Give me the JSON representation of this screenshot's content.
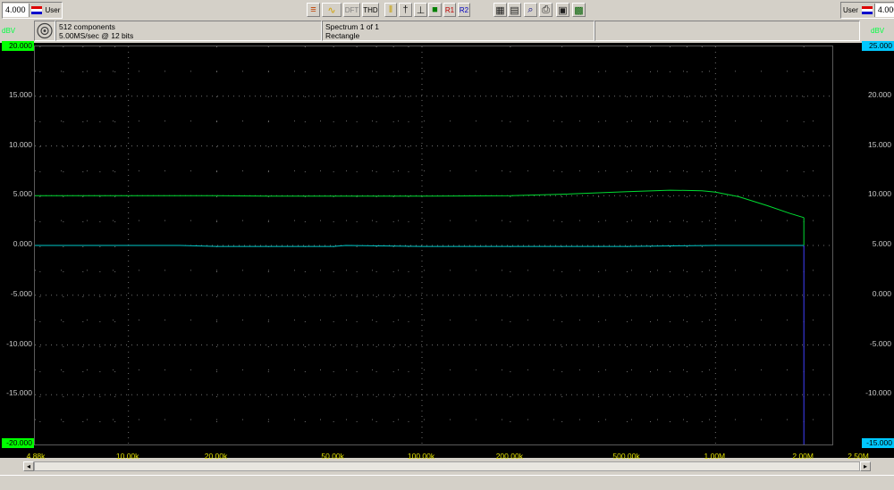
{
  "toolbar": {
    "left_scale": "4.000",
    "right_scale": "4.000",
    "user_label": "User",
    "buttons": [
      {
        "label": "",
        "icon": "filter-icon"
      },
      {
        "label": "",
        "icon": "waveform-icon"
      },
      {
        "label": "DFT",
        "icon": ""
      },
      {
        "label": "THD",
        "icon": ""
      },
      {
        "label": "",
        "icon": "pause-bars-icon"
      },
      {
        "label": "",
        "icon": "marker-icon"
      },
      {
        "label": "",
        "icon": "measure-icon"
      },
      {
        "label": "",
        "icon": "reference-plot-icon"
      },
      {
        "label": "R1",
        "icon": ""
      },
      {
        "label": "R2",
        "icon": ""
      },
      {
        "label": "",
        "icon": "settings-grid-icon"
      },
      {
        "label": "",
        "icon": "sheets-icon"
      },
      {
        "label": "",
        "icon": "zoom-icon"
      },
      {
        "label": "",
        "icon": "print-icon"
      },
      {
        "label": "",
        "icon": "save-icon"
      },
      {
        "label": "",
        "icon": "display-icon"
      }
    ]
  },
  "info": {
    "components": "512 components",
    "rate": "5.00MS/sec @ 12 bits",
    "spectrum": "Spectrum 1 of 1",
    "window": "Rectangle"
  },
  "colors": {
    "trace_a": "#00dc32",
    "trace_b": "#00c8c8",
    "grid_dot": "#707070",
    "left_box": "#00ff00",
    "right_box": "#00c8ff",
    "x_label": "#e0e000"
  },
  "chart_data": {
    "type": "line",
    "x_scale": "log",
    "xlim": [
      4800,
      2500000
    ],
    "ylim_left": [
      -20,
      20
    ],
    "ylim_right": [
      -15,
      25
    ],
    "left_unit": "dBV",
    "right_unit": "dBV",
    "left_ticks": [
      "20.000",
      "15.000",
      "10.000",
      "5.000",
      "0.000",
      "-5.000",
      "-10.000",
      "-15.000",
      "-20.000"
    ],
    "right_ticks": [
      "25.000",
      "20.000",
      "15.000",
      "10.000",
      "5.000",
      "0.000",
      "-5.000",
      "-10.000",
      "-15.000"
    ],
    "x_tick_labels": [
      {
        "x": 4800,
        "label": "4.88k"
      },
      {
        "x": 10000,
        "label": "10.00k"
      },
      {
        "x": 20000,
        "label": "20.00k"
      },
      {
        "x": 50000,
        "label": "50.00k"
      },
      {
        "x": 100000,
        "label": "100.00k"
      },
      {
        "x": 200000,
        "label": "200.00k"
      },
      {
        "x": 500000,
        "label": "500.00k"
      },
      {
        "x": 1000000,
        "label": "1.00M"
      },
      {
        "x": 2000000,
        "label": "2.00M"
      },
      {
        "x": 2500000,
        "label": "2.50M"
      }
    ],
    "series": [
      {
        "axis": "left",
        "color": "#00dc32",
        "x": [
          4800,
          10000,
          20000,
          30000,
          50000,
          100000,
          200000,
          300000,
          500000,
          700000,
          900000,
          1000000,
          1200000,
          1500000,
          1800000,
          2000000
        ],
        "y": [
          5.0,
          5.0,
          5.0,
          4.95,
          4.95,
          4.95,
          5.0,
          5.15,
          5.4,
          5.55,
          5.5,
          5.35,
          4.9,
          4.0,
          3.2,
          2.8
        ]
      },
      {
        "axis": "left",
        "color": "#00c8c8",
        "x": [
          4800,
          10000,
          15000,
          20000,
          50000,
          55000,
          100000,
          200000,
          500000,
          1000000,
          2000000
        ],
        "y": [
          0.0,
          0.0,
          0.0,
          -0.1,
          -0.1,
          0.0,
          -0.1,
          -0.1,
          -0.1,
          0.0,
          0.0
        ]
      }
    ]
  }
}
